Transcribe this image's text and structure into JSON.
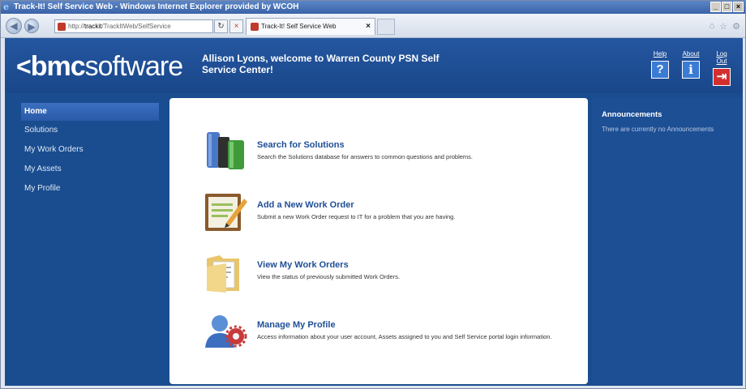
{
  "window": {
    "title": "Track-It! Self Service Web - Windows Internet Explorer provided by WCOH",
    "controls": [
      "_",
      "□",
      "×"
    ]
  },
  "browser": {
    "address_prefix": "http://",
    "address_host": "trackit",
    "address_path": "/TrackItWeb/SelfService",
    "tab_title": "Track-It! Self Service Web",
    "tab_close": "×",
    "refresh_glyph": "↻",
    "stop_glyph": "×",
    "tool_glyphs": [
      "⌂",
      "☆",
      "⚙"
    ]
  },
  "header": {
    "logo_chevron": "<",
    "logo_bold": "bmc",
    "logo_light": "software",
    "welcome": "Allison Lyons, welcome to Warren County PSN Self Service Center!",
    "links": [
      {
        "label": "Help",
        "glyph": "?",
        "icon": "help-icon"
      },
      {
        "label": "About",
        "glyph": "i",
        "icon": "info-icon"
      },
      {
        "label": "Log Out",
        "glyph": "⇥",
        "icon": "logout-icon"
      }
    ]
  },
  "sidebar": {
    "items": [
      {
        "label": "Home",
        "active": true
      },
      {
        "label": "Solutions"
      },
      {
        "label": "My Work Orders"
      },
      {
        "label": "My Assets"
      },
      {
        "label": "My Profile"
      }
    ]
  },
  "main": {
    "options": [
      {
        "title": "Search for Solutions",
        "description": "Search the Solutions database for answers to common questions and problems.",
        "icon": "books-icon"
      },
      {
        "title": "Add a New Work Order",
        "description": "Submit a new Work Order request to IT for a problem that you are having.",
        "icon": "notepad-icon"
      },
      {
        "title": "View My Work Orders",
        "description": "View the status of previously submitted Work Orders.",
        "icon": "folder-icon"
      },
      {
        "title": "Manage My Profile",
        "description": "Access information about your user account, Assets assigned to you and Self Service portal login information.",
        "icon": "user-gear-icon"
      }
    ]
  },
  "announcements": {
    "title": "Announcements",
    "text": "There are currently no Announcements"
  }
}
